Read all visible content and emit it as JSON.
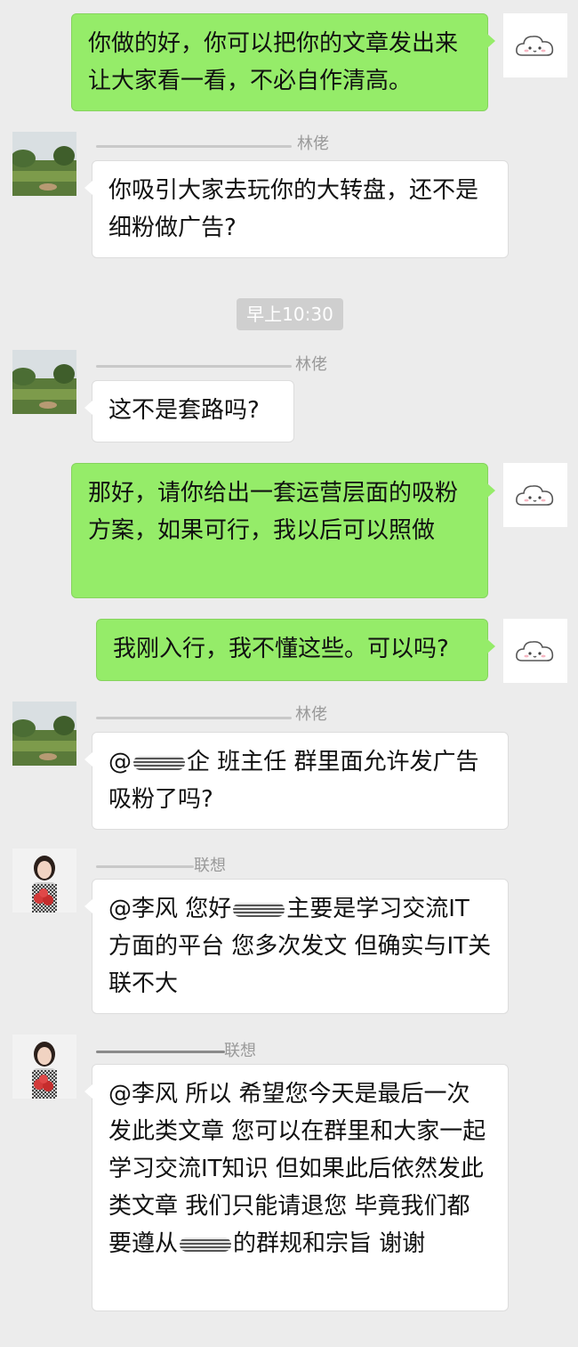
{
  "time_divider": "早上10:30",
  "messages": [
    {
      "text": "你做的好，你可以把你的文章发出来让大家看一看，不必自作清高。"
    },
    {
      "sender": "林佬",
      "text": "你吸引大家去玩你的大转盘，还不是细粉做广告?"
    },
    {
      "sender": "林佬",
      "text": "这不是套路吗?"
    },
    {
      "text": "那好，请你给出一套运营层面的吸粉方案，如果可行，我以后可以照做"
    },
    {
      "text": "我刚入行，我不懂这些。可以吗?"
    },
    {
      "sender": "林佬",
      "mention": "@",
      "mention_tail": "企",
      "text": " 班主任  群里面允许发广告吸粉了吗?"
    },
    {
      "sender": "联想",
      "prefix": "@李风 您好",
      "mid": "主要是学习交流IT方面的平台 您多次发文 但确实与IT关联不大"
    },
    {
      "sender": "联想",
      "prefix": "@李风 所以 希望您今天是最后一次发此类文章 您可以在群里和大家一起学习交流IT知识 但如果此后依然发此类文章 我们只能请退您 毕竟我们都要遵从",
      "mid": "的群规和宗旨 谢谢"
    }
  ],
  "colors": {
    "outgoing_bubble": "#95ec69",
    "incoming_bubble": "#ffffff",
    "background": "#ececec"
  }
}
